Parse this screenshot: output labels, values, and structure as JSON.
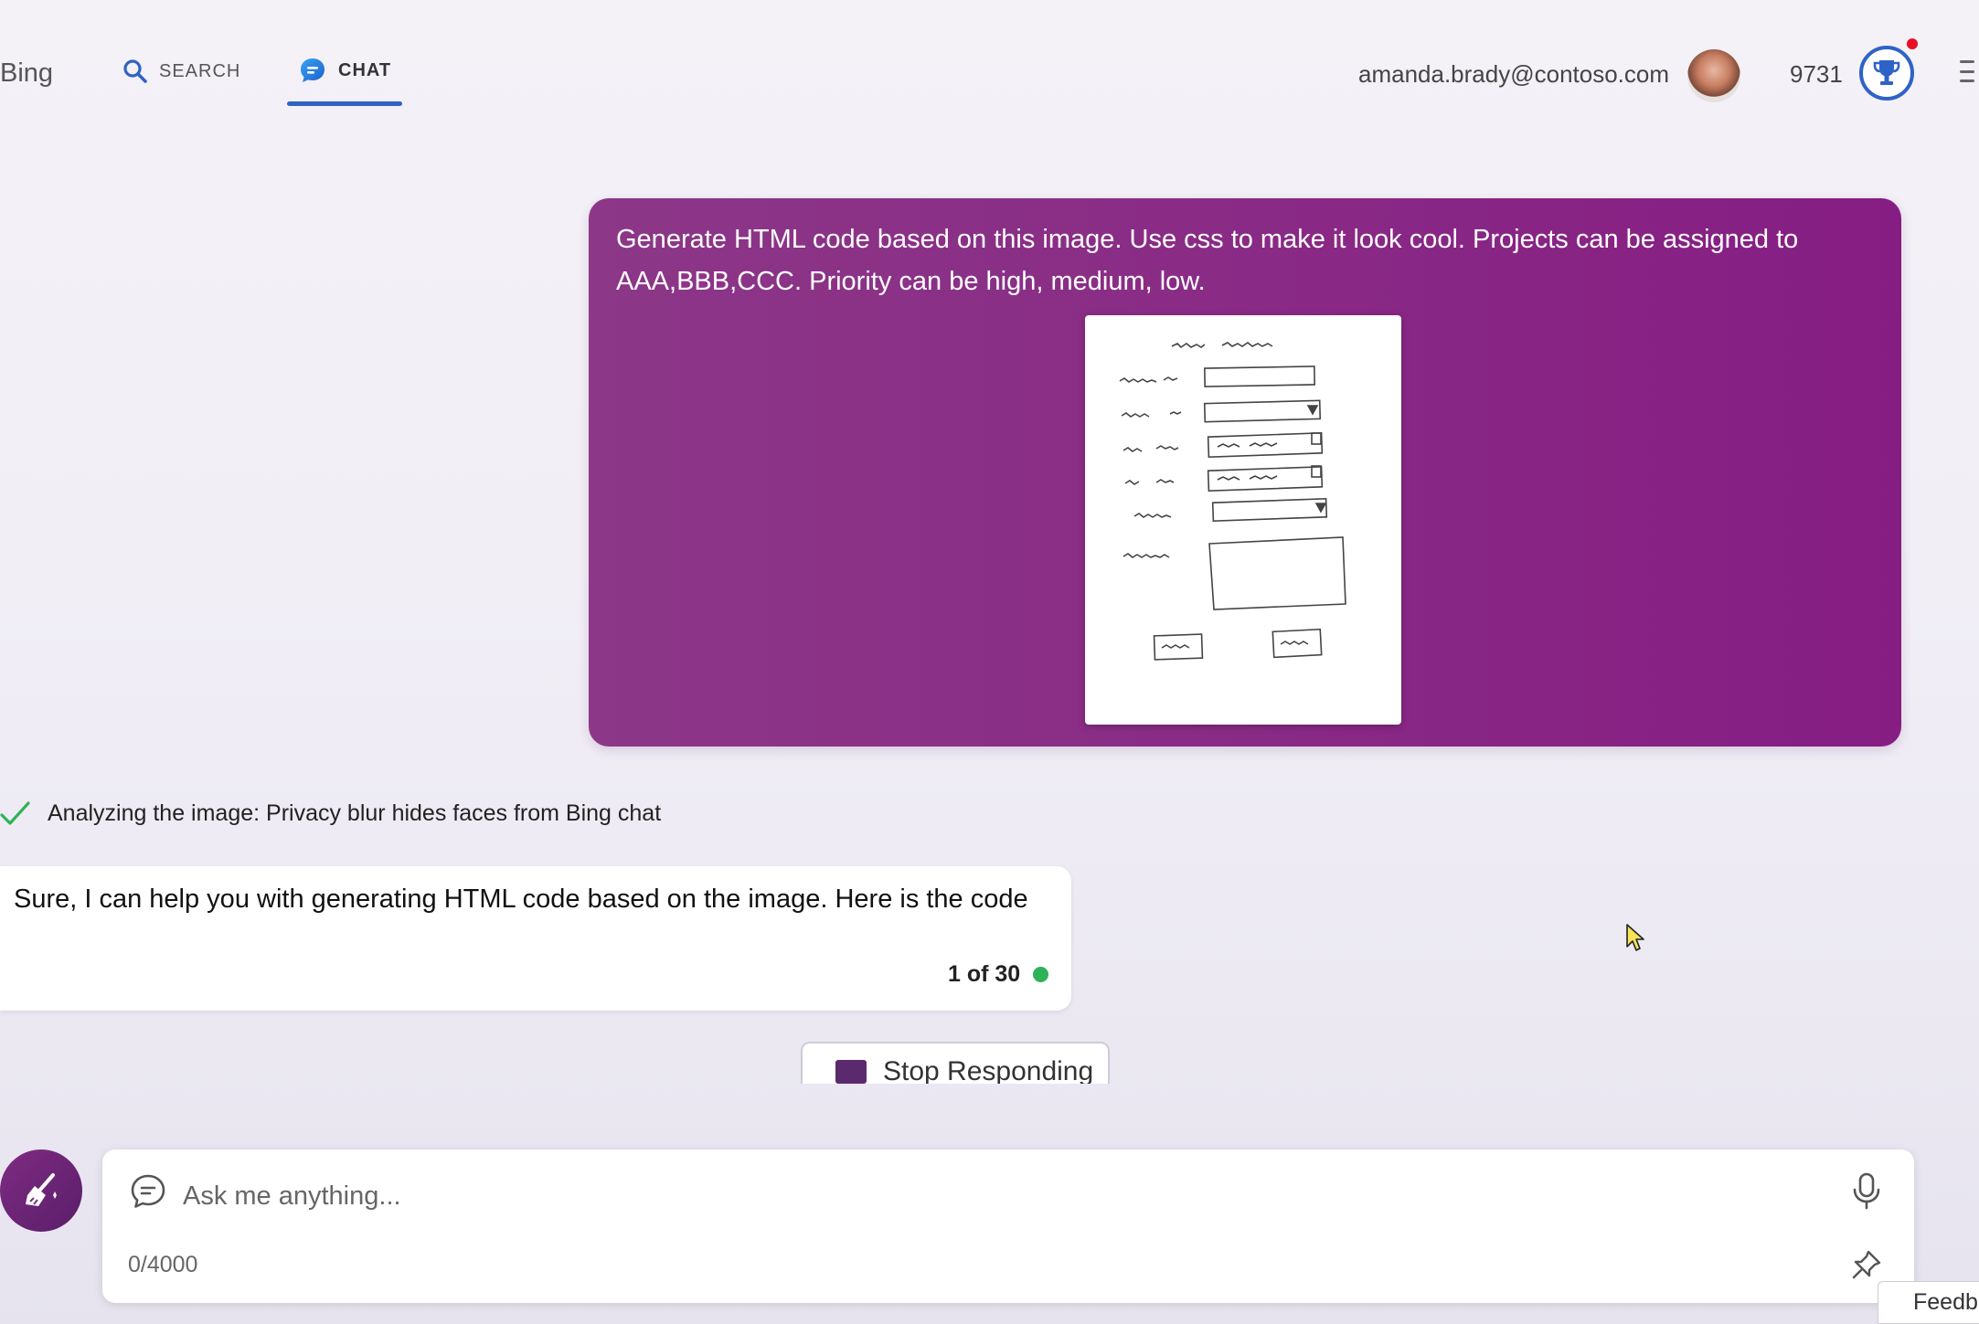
{
  "header": {
    "brand": "Bing",
    "tabs": [
      {
        "label": "SEARCH",
        "icon": "search-icon"
      },
      {
        "label": "CHAT",
        "icon": "chat-icon",
        "active": true
      }
    ],
    "user_email": "amanda.brady@contoso.com",
    "reward_points": "9731",
    "accent_color": "#2f62c6"
  },
  "conversation": {
    "user_message": {
      "text": "Generate HTML code based on this image. Use css to make it look cool. Projects can be assigned to AAA,BBB,CCC. Priority can be high, medium, low.",
      "bubble_color": "#8a2d86",
      "attachment": "hand-drawn-form-sketch"
    },
    "status": {
      "text": "Analyzing the image: Privacy blur hides faces from Bing chat",
      "icon": "checkmark-icon"
    },
    "bot_message": {
      "text": "Sure, I can help you with generating HTML code based on the image. Here is the code",
      "counter": "1 of 30",
      "counter_status_color": "#2fb35a"
    },
    "stop_button_label": "Stop Responding"
  },
  "composer": {
    "placeholder": "Ask me anything...",
    "char_count": "0/4000"
  },
  "feedback_label": "Feedback"
}
